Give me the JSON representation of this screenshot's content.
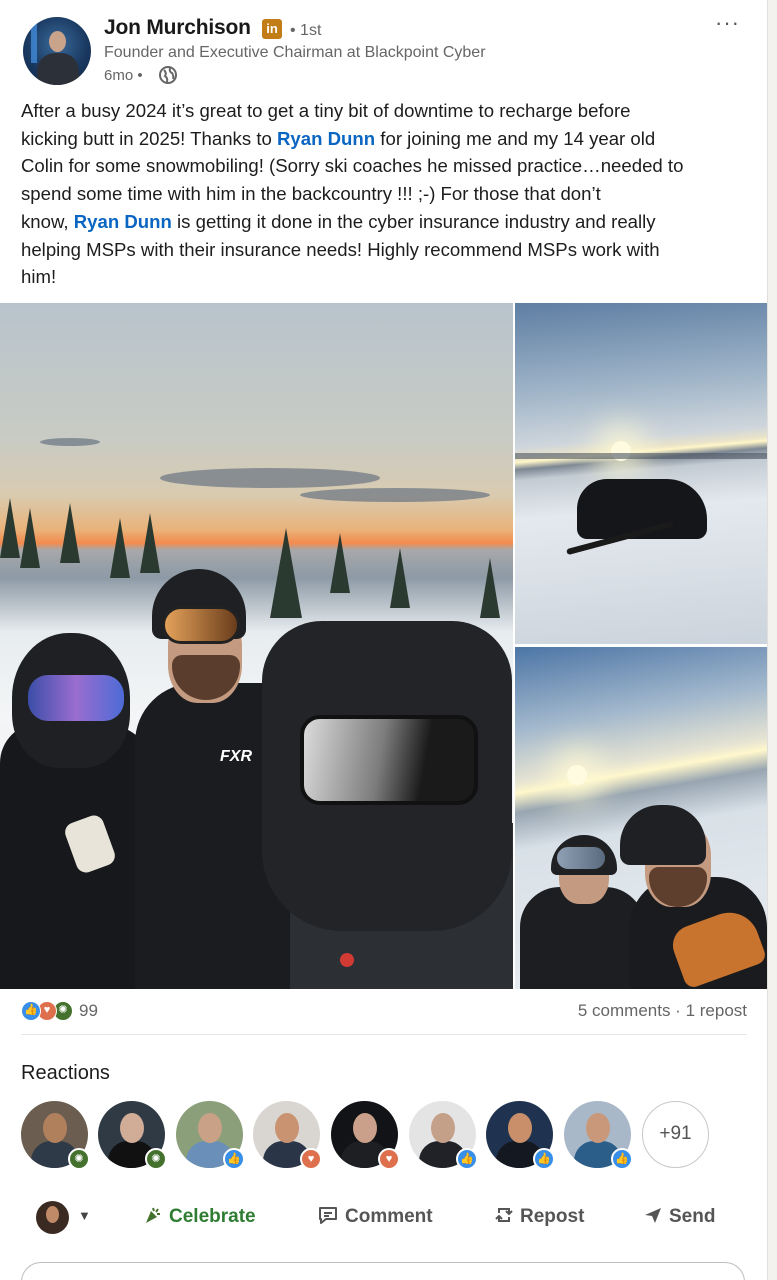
{
  "post": {
    "author": {
      "name": "Jon Murchison",
      "badge": "in",
      "degree": "• 1st",
      "headline": "Founder and Executive Chairman at Blackpoint Cyber",
      "time": "6mo •",
      "visibility_icon": "globe-icon"
    },
    "more_label": "···",
    "text": {
      "l1": "After a busy 2024 it’s great to get a tiny bit of downtime to recharge before",
      "l2_before": "kicking butt in 2025! Thanks to ",
      "mention1": "Ryan Dunn",
      "l2_after": " for joining me and my 14 year old",
      "l3": "Colin for some snowmobiling! (Sorry ski coaches he missed practice…needed to",
      "l4": "spend some time with him in the backcountry !!! ;-) For those that don’t",
      "l5_before": "know, ",
      "mention2": "Ryan Dunn",
      "l5_after": " is getting it done in the cyber insurance industry and really",
      "l6": "helping MSPs with their insurance needs! Highly recommend MSPs work with",
      "l7": "him!"
    },
    "brand_text": "FXR"
  },
  "stats": {
    "reaction_icons": [
      "like-icon",
      "love-icon",
      "celebrate-icon"
    ],
    "reaction_count": "99",
    "comments_reposts": "5 comments · 1 repost"
  },
  "reactions": {
    "title": "Reactions",
    "more_count": "+91"
  },
  "actions": {
    "celebrate": "Celebrate",
    "comment": "Comment",
    "repost": "Repost",
    "send": "Send"
  },
  "colors": {
    "link": "#0a66c2",
    "celebrate": "#2e7d32",
    "like": "#378fe9",
    "love": "#df704d"
  }
}
